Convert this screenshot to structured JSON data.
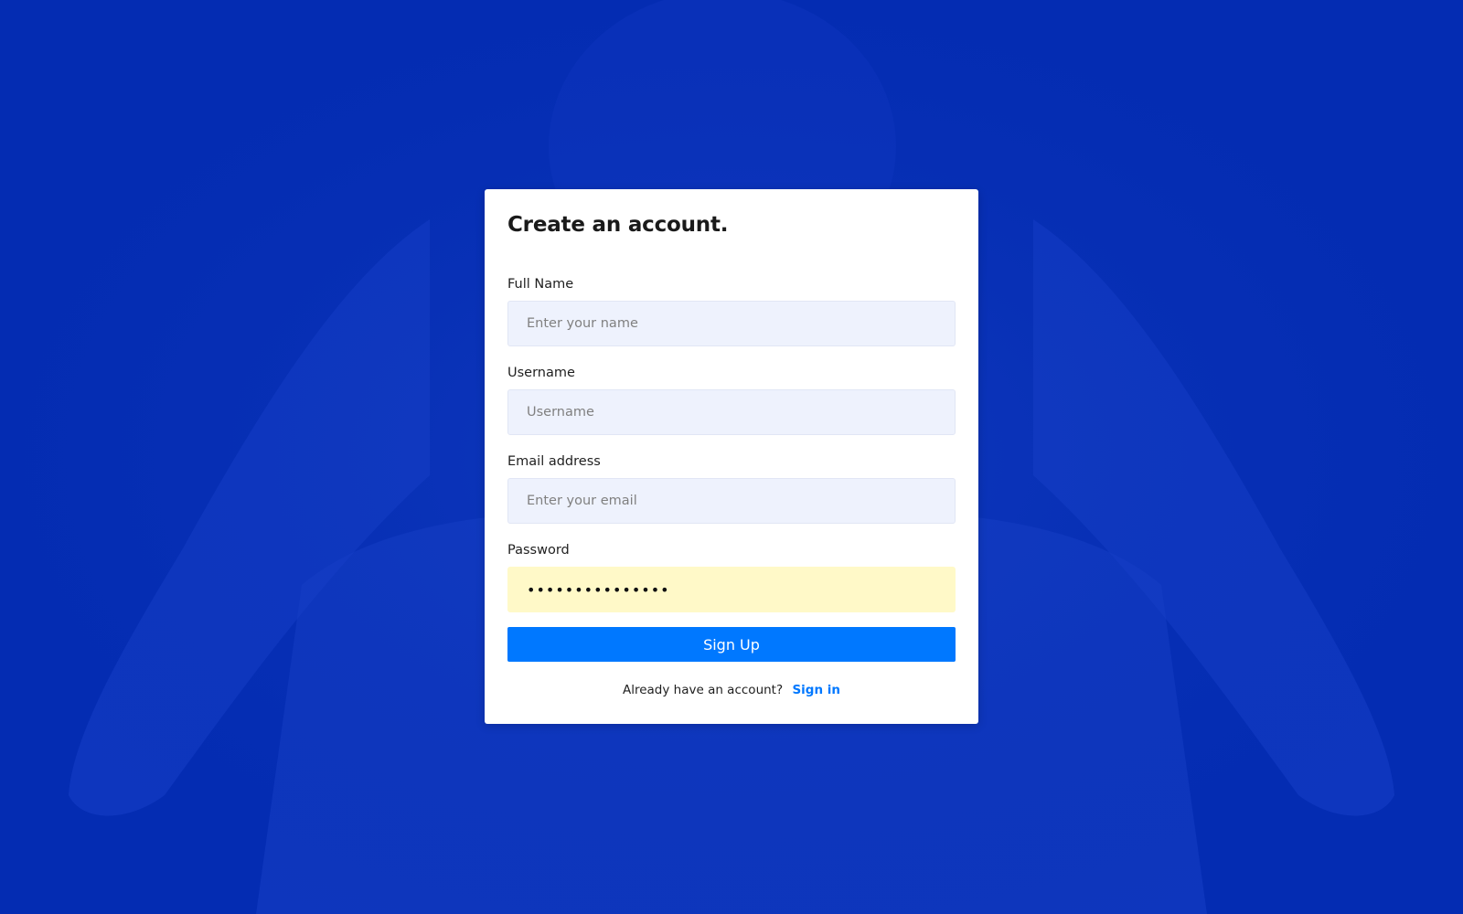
{
  "colors": {
    "background": "#042cb2",
    "card": "#ffffff",
    "input_background": "#eef2fd",
    "autofill_background": "#fff9c8",
    "accent": "#0078ff"
  },
  "form": {
    "title": "Create an account.",
    "fields": [
      {
        "label": "Full Name",
        "placeholder": "Enter your name",
        "value": ""
      },
      {
        "label": "Username",
        "placeholder": "Username",
        "value": ""
      },
      {
        "label": "Email address",
        "placeholder": "Enter your email",
        "value": ""
      },
      {
        "label": "Password",
        "placeholder": "",
        "value": "•••••••••••••••"
      }
    ],
    "submit_label": "Sign Up",
    "footer_text": "Already have an account?",
    "signin_label": "Sign in"
  }
}
